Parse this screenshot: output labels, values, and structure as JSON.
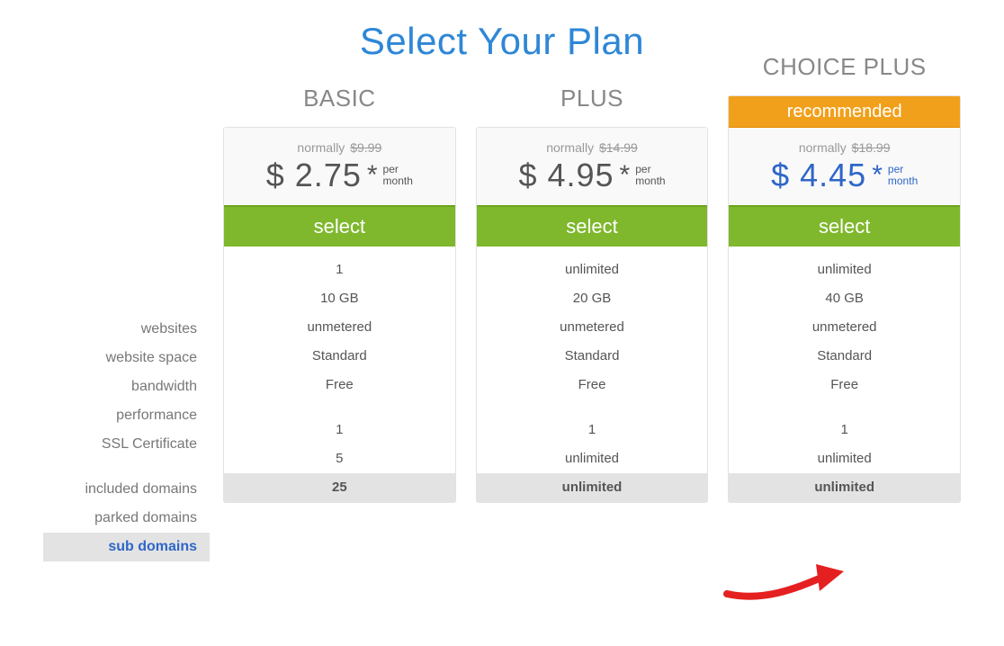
{
  "title": "Select Your Plan",
  "recommended_label": "recommended",
  "normally_prefix": "normally",
  "per_top": "per",
  "per_bottom": "month",
  "select_label": "select",
  "feature_labels": [
    "websites",
    "website space",
    "bandwidth",
    "performance",
    "SSL Certificate",
    "included domains",
    "parked domains",
    "sub domains"
  ],
  "highlight_row_index": 7,
  "plans": [
    {
      "name": "BASIC",
      "old": "$9.99",
      "price": "$ 2.75",
      "values": [
        "1",
        "10 GB",
        "unmetered",
        "Standard",
        "Free",
        "1",
        "5",
        "25"
      ],
      "recommended": false
    },
    {
      "name": "PLUS",
      "old": "$14.99",
      "price": "$ 4.95",
      "values": [
        "unlimited",
        "20 GB",
        "unmetered",
        "Standard",
        "Free",
        "1",
        "unlimited",
        "unlimited"
      ],
      "recommended": false
    },
    {
      "name": "CHOICE PLUS",
      "old": "$18.99",
      "price": "$ 4.45",
      "values": [
        "unlimited",
        "40 GB",
        "unmetered",
        "Standard",
        "Free",
        "1",
        "unlimited",
        "unlimited"
      ],
      "recommended": true
    }
  ]
}
